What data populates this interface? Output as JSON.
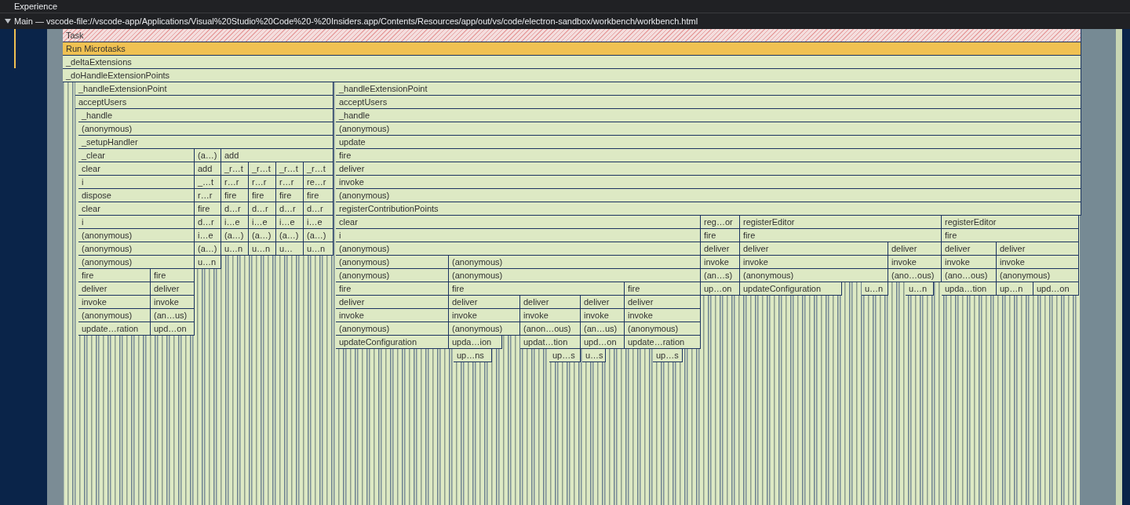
{
  "track_header": {
    "title": "Experience"
  },
  "thread": {
    "title": "Main — vscode-file://vscode-app/Applications/Visual%20Studio%20Code%20-%20Insiders.app/Contents/Resources/app/out/vs/code/electron-sandbox/workbench/workbench.html",
    "expanded": true
  },
  "flame_rows": [
    {
      "frames": [
        {
          "label": "Task",
          "kind": "task"
        }
      ]
    },
    {
      "frames": [
        {
          "label": "Run Microtasks",
          "kind": "microtask"
        }
      ]
    },
    {
      "frames": [
        {
          "label": "_deltaExtensions",
          "kind": "function"
        }
      ]
    },
    {
      "frames": [
        {
          "label": "_doHandleExtensionPoints",
          "kind": "function"
        }
      ]
    },
    {
      "frames": [
        {
          "label": "_handleExtensionPoint",
          "kind": "function"
        },
        {
          "label": "_handleExtensionPoint",
          "kind": "function"
        }
      ]
    },
    {
      "frames": [
        {
          "label": "acceptUsers",
          "kind": "function"
        },
        {
          "label": "acceptUsers",
          "kind": "function"
        }
      ]
    },
    {
      "frames": [
        {
          "label": "_handle",
          "kind": "function"
        },
        {
          "label": "_handle",
          "kind": "function"
        }
      ]
    },
    {
      "frames": [
        {
          "label": "(anonymous)",
          "kind": "function"
        },
        {
          "label": "(anonymous)",
          "kind": "function"
        }
      ]
    },
    {
      "frames": [
        {
          "label": "_setupHandler",
          "kind": "function"
        },
        {
          "label": "update",
          "kind": "function"
        }
      ]
    },
    {
      "frames": [
        {
          "label": "_clear",
          "kind": "function"
        },
        {
          "label": "(a…)",
          "kind": "function"
        },
        {
          "label": "add",
          "kind": "function"
        },
        {
          "label": "fire",
          "kind": "function"
        }
      ]
    },
    {
      "frames": [
        {
          "label": "clear",
          "kind": "function"
        },
        {
          "label": "add",
          "kind": "function"
        },
        {
          "label": "_r…t",
          "kind": "function"
        },
        {
          "label": "_r…t",
          "kind": "function"
        },
        {
          "label": "_r…t",
          "kind": "function"
        },
        {
          "label": "_r…t",
          "kind": "function"
        },
        {
          "label": "deliver",
          "kind": "function"
        }
      ]
    },
    {
      "frames": [
        {
          "label": "i",
          "kind": "function"
        },
        {
          "label": "_…t",
          "kind": "function"
        },
        {
          "label": "r…r",
          "kind": "function"
        },
        {
          "label": "r…r",
          "kind": "function"
        },
        {
          "label": "r…r",
          "kind": "function"
        },
        {
          "label": "re…r",
          "kind": "function"
        },
        {
          "label": "invoke",
          "kind": "function"
        }
      ]
    },
    {
      "frames": [
        {
          "label": "dispose",
          "kind": "function"
        },
        {
          "label": "r…r",
          "kind": "function"
        },
        {
          "label": "fire",
          "kind": "function"
        },
        {
          "label": "fire",
          "kind": "function"
        },
        {
          "label": "fire",
          "kind": "function"
        },
        {
          "label": "fire",
          "kind": "function"
        },
        {
          "label": "(anonymous)",
          "kind": "function"
        }
      ]
    },
    {
      "frames": [
        {
          "label": "clear",
          "kind": "function"
        },
        {
          "label": "fire",
          "kind": "function"
        },
        {
          "label": "d…r",
          "kind": "function"
        },
        {
          "label": "d…r",
          "kind": "function"
        },
        {
          "label": "d…r",
          "kind": "function"
        },
        {
          "label": "d…r",
          "kind": "function"
        },
        {
          "label": "registerContributionPoints",
          "kind": "function"
        }
      ]
    },
    {
      "frames": [
        {
          "label": "i",
          "kind": "function"
        },
        {
          "label": "d…r",
          "kind": "function"
        },
        {
          "label": "i…e",
          "kind": "function"
        },
        {
          "label": "i…e",
          "kind": "function"
        },
        {
          "label": "i…e",
          "kind": "function"
        },
        {
          "label": "i…e",
          "kind": "function"
        },
        {
          "label": "clear",
          "kind": "function"
        },
        {
          "label": "reg…or",
          "kind": "function"
        },
        {
          "label": "registerEditor",
          "kind": "function"
        },
        {
          "label": "registerEditor",
          "kind": "function"
        }
      ]
    },
    {
      "frames": [
        {
          "label": "(anonymous)",
          "kind": "function"
        },
        {
          "label": "i…e",
          "kind": "function"
        },
        {
          "label": "(a…)",
          "kind": "function"
        },
        {
          "label": "(a…)",
          "kind": "function"
        },
        {
          "label": "(a…)",
          "kind": "function"
        },
        {
          "label": "(a…)",
          "kind": "function"
        },
        {
          "label": "i",
          "kind": "function"
        },
        {
          "label": "fire",
          "kind": "function"
        },
        {
          "label": "fire",
          "kind": "function"
        },
        {
          "label": "fire",
          "kind": "function"
        }
      ]
    },
    {
      "frames": [
        {
          "label": "(anonymous)",
          "kind": "function"
        },
        {
          "label": "(a…)",
          "kind": "function"
        },
        {
          "label": "u…n",
          "kind": "function"
        },
        {
          "label": "u…n",
          "kind": "function"
        },
        {
          "label": "u…",
          "kind": "function"
        },
        {
          "label": "u…n",
          "kind": "function"
        },
        {
          "label": "(anonymous)",
          "kind": "function"
        },
        {
          "label": "deliver",
          "kind": "function"
        },
        {
          "label": "deliver",
          "kind": "function"
        },
        {
          "label": "deliver",
          "kind": "function"
        },
        {
          "label": "deliver",
          "kind": "function"
        },
        {
          "label": "deliver",
          "kind": "function"
        }
      ]
    },
    {
      "frames": [
        {
          "label": "(anonymous)",
          "kind": "function"
        },
        {
          "label": "u…n",
          "kind": "function"
        },
        {
          "label": "(anonymous)",
          "kind": "function"
        },
        {
          "label": "(anonymous)",
          "kind": "function"
        },
        {
          "label": "invoke",
          "kind": "function"
        },
        {
          "label": "invoke",
          "kind": "function"
        },
        {
          "label": "invoke",
          "kind": "function"
        },
        {
          "label": "invoke",
          "kind": "function"
        },
        {
          "label": "invoke",
          "kind": "function"
        }
      ]
    },
    {
      "frames": [
        {
          "label": "fire",
          "kind": "function"
        },
        {
          "label": "fire",
          "kind": "function"
        },
        {
          "label": "(anonymous)",
          "kind": "function"
        },
        {
          "label": "(anonymous)",
          "kind": "function"
        },
        {
          "label": "(an…s)",
          "kind": "function"
        },
        {
          "label": "(anonymous)",
          "kind": "function"
        },
        {
          "label": "(ano…ous)",
          "kind": "function"
        },
        {
          "label": "(ano…ous)",
          "kind": "function"
        },
        {
          "label": "(anonymous)",
          "kind": "function"
        }
      ]
    },
    {
      "frames": [
        {
          "label": "deliver",
          "kind": "function"
        },
        {
          "label": "deliver",
          "kind": "function"
        },
        {
          "label": "fire",
          "kind": "function"
        },
        {
          "label": "fire",
          "kind": "function"
        },
        {
          "label": "fire",
          "kind": "function"
        },
        {
          "label": "up…on",
          "kind": "function"
        },
        {
          "label": "updateConfiguration",
          "kind": "function"
        },
        {
          "label": "u…n",
          "kind": "function"
        },
        {
          "label": "u…n",
          "kind": "function"
        },
        {
          "label": "upda…tion",
          "kind": "function"
        },
        {
          "label": "up…n",
          "kind": "function"
        },
        {
          "label": "upd…on",
          "kind": "function"
        }
      ]
    },
    {
      "frames": [
        {
          "label": "invoke",
          "kind": "function"
        },
        {
          "label": "invoke",
          "kind": "function"
        },
        {
          "label": "deliver",
          "kind": "function"
        },
        {
          "label": "deliver",
          "kind": "function"
        },
        {
          "label": "deliver",
          "kind": "function"
        },
        {
          "label": "deliver",
          "kind": "function"
        },
        {
          "label": "deliver",
          "kind": "function"
        }
      ]
    },
    {
      "frames": [
        {
          "label": "(anonymous)",
          "kind": "function"
        },
        {
          "label": "(an…us)",
          "kind": "function"
        },
        {
          "label": "invoke",
          "kind": "function"
        },
        {
          "label": "invoke",
          "kind": "function"
        },
        {
          "label": "invoke",
          "kind": "function"
        },
        {
          "label": "invoke",
          "kind": "function"
        },
        {
          "label": "invoke",
          "kind": "function"
        }
      ]
    },
    {
      "frames": [
        {
          "label": "update…ration",
          "kind": "function"
        },
        {
          "label": "upd…on",
          "kind": "function"
        },
        {
          "label": "(anonymous)",
          "kind": "function"
        },
        {
          "label": "(anonymous)",
          "kind": "function"
        },
        {
          "label": "(anon…ous)",
          "kind": "function"
        },
        {
          "label": "(an…us)",
          "kind": "function"
        },
        {
          "label": "(anonymous)",
          "kind": "function"
        }
      ]
    },
    {
      "frames": [
        {
          "label": "updateConfiguration",
          "kind": "function"
        },
        {
          "label": "upda…ion",
          "kind": "function"
        },
        {
          "label": "updat…tion",
          "kind": "function"
        },
        {
          "label": "upd…on",
          "kind": "function"
        },
        {
          "label": "update…ration",
          "kind": "function"
        }
      ]
    },
    {
      "frames": [
        {
          "label": "up…ns",
          "kind": "function"
        },
        {
          "label": "up…s",
          "kind": "function"
        },
        {
          "label": "u…s",
          "kind": "function"
        },
        {
          "label": "up…s",
          "kind": "function"
        }
      ]
    }
  ]
}
